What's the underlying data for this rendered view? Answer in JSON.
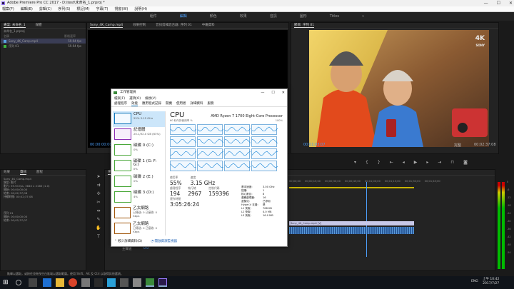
{
  "titlebar": {
    "title": "Adobe Premiere Pro CC 2017 - D:\\test\\未命名_1.prproj *",
    "min": "—",
    "max": "☐",
    "close": "✕"
  },
  "menubar": {
    "items": [
      "檔案(F)",
      "編輯(E)",
      "剪輯(C)",
      "序列(S)",
      "標記(M)",
      "字幕(T)",
      "視窗(W)",
      "說明(H)"
    ]
  },
  "workspaces": {
    "items": [
      "組件",
      "編輯",
      "顏色",
      "效果",
      "音訊",
      "圖形",
      "Titles"
    ],
    "active_index": 1,
    "overflow": "»"
  },
  "project": {
    "tab1": "專案: 未命名_1",
    "tab2": "媒體",
    "path": "未命名_1.prproj",
    "col_name": "名稱",
    "col_fps": "影格速率",
    "items": [
      {
        "name": "Sony_4K_Camp.mp4",
        "fps": "59.94 fps"
      },
      {
        "name": "序列 01",
        "fps": "59.94 fps"
      }
    ]
  },
  "source": {
    "tab1": "Sony_4K_Camp.mp4",
    "tab2": "效果控制",
    "tab3": "音訊剪輯混合器: 序列 01",
    "tab4": "中繼資料",
    "timecode": "00:00:00:00"
  },
  "program": {
    "tab": "節目: 序列 01",
    "timecode": "00:01:03:07",
    "fit": "完整",
    "duration": "00:02:37:08",
    "watermark": "4K",
    "watermark_brand": "SONY"
  },
  "info": {
    "tab1": "效果",
    "tab2": "資訊",
    "tab3": "歷程",
    "clip": "Sony_4K_Camp.mp4",
    "type": "類型: 影片",
    "specs": "影片: 59.94 fps, 3840 x 2160 (1.0)",
    "lines": [
      "開始: 00;00;00;00",
      "結束: 00;02;37;08",
      "持續時間: 00;02;37;08"
    ],
    "seq": "序列 01",
    "seq_lines": [
      "開始: 00;00;00;00",
      "結束: 00;02;37;07"
    ]
  },
  "timeline": {
    "tab": "序列 01",
    "timecode": "00:01:03:07",
    "ruler": [
      "00;00;00",
      "00;00;15;00",
      "00;00;30;00",
      "00;00;45;00",
      "00;01;00;00",
      "00;01;15;00",
      "00;01;30;00",
      "00;01;45;00",
      "00;02;00;00",
      "00;02;15;00"
    ],
    "clip": "Sony_4K_Camp.mp4 [V]",
    "tracks": [
      "V3",
      "V2",
      "V1",
      "A1",
      "A2",
      "A3",
      "主聲道"
    ],
    "master_value": "0.0"
  },
  "meter_labels": [
    "0",
    "-6",
    "-12",
    "-18",
    "-24",
    "-30",
    "-36",
    "-42",
    "-48",
    "-54"
  ],
  "statusbar": {
    "text": "點擊以選取，或按住並拖曳空白區域以選取範圍。使用 Shift、Alt 及 Ctrl 以取得其他選項。"
  },
  "taskmgr": {
    "title": "工作管理員",
    "menu": [
      "檔案(F)",
      "選項(O)",
      "檢視(V)"
    ],
    "tabs": [
      "處理程序",
      "效能",
      "應用程式記錄",
      "開機",
      "使用者",
      "詳細資料",
      "服務"
    ],
    "side": [
      {
        "name": "CPU",
        "sub": "55% 3.15 GHz",
        "color": "#1785d8"
      },
      {
        "name": "記憶體",
        "sub": "20.1/32.0 GB (63%)",
        "color": "#8b2db4"
      },
      {
        "name": "磁碟 0 (C:)",
        "sub": "0%",
        "color": "#4aa83a"
      },
      {
        "name": "磁碟 1 (G: F: G:)",
        "sub": "0%",
        "color": "#4aa83a"
      },
      {
        "name": "磁碟 2 (E:)",
        "sub": "0%",
        "color": "#4aa83a"
      },
      {
        "name": "磁碟 3 (D:)",
        "sub": "4%",
        "color": "#4aa83a"
      },
      {
        "name": "乙太網路",
        "sub": "已傳送: 0 已接收: 0 Kbps",
        "color": "#a1570c"
      },
      {
        "name": "乙太網路",
        "sub": "已傳送: 0 已接收: 0 Kbps",
        "color": "#a1570c"
      }
    ],
    "cpu_title": "CPU",
    "cpu_model": "AMD Ryzen 7 1700 Eight-Core Processor",
    "graph_label": "60 秒內的使用率 %",
    "graph_max": "100%",
    "util_label": "使用率",
    "util": "55%",
    "speed_label": "速度",
    "speed": "3.15 GHz",
    "proc_label": "處理程序",
    "proc": "194",
    "threads_label": "執行緒",
    "threads": "2967",
    "handles_label": "控制代碼",
    "handles": "159396",
    "uptime_label": "運作時間",
    "uptime": "3:05:26:24",
    "specs": [
      [
        "基本速度:",
        "3.00 GHz"
      ],
      [
        "插槽:",
        "1"
      ],
      [
        "核心數目:",
        "8"
      ],
      [
        "邏輯處理器:",
        "16"
      ],
      [
        "虛擬化:",
        "已停用"
      ],
      [
        "Hyper-V 支援:",
        "是"
      ],
      [
        "L1 快取:",
        "768 KB"
      ],
      [
        "L2 快取:",
        "4.0 MB"
      ],
      [
        "L3 快取:",
        "16.0 MB"
      ]
    ],
    "fewer": "較少詳細資料(D)",
    "monitor": "開啟資源監視器"
  },
  "taskbar": {
    "time": "上午 10:42",
    "date": "2017/7/27",
    "lang": "ENG"
  }
}
